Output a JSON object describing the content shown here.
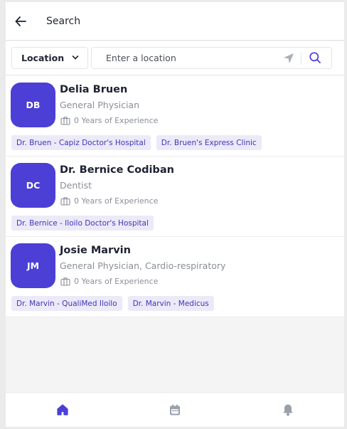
{
  "header": {
    "title": "Search",
    "back_icon": "arrow-left-icon"
  },
  "search": {
    "location_label": "Location",
    "placeholder": "Enter a location",
    "value": "",
    "icons": [
      "chevron-down-icon",
      "navigation-arrow-icon",
      "search-icon"
    ]
  },
  "doctors": [
    {
      "initials": "DB",
      "name": "Delia Bruen",
      "specialty": "General Physician",
      "experience": "0 Years of Experience",
      "clinics": [
        "Dr. Bruen - Capiz Doctor's Hospital",
        "Dr. Bruen's Express Clinic"
      ]
    },
    {
      "initials": "DC",
      "name": "Dr. Bernice Codiban",
      "specialty": "Dentist",
      "experience": "0 Years of Experience",
      "clinics": [
        "Dr. Bernice - Iloilo Doctor's Hospital"
      ]
    },
    {
      "initials": "JM",
      "name": "Josie Marvin",
      "specialty": "General Physician, Cardio-respiratory",
      "experience": "0 Years of Experience",
      "clinics": [
        "Dr. Marvin - QualiMed Iloilo",
        "Dr. Marvin - Medicus"
      ]
    }
  ],
  "bottom_nav": {
    "items": [
      {
        "icon": "home-icon",
        "active": true
      },
      {
        "icon": "calendar-icon",
        "active": false
      },
      {
        "icon": "bell-icon",
        "active": false
      }
    ]
  },
  "colors": {
    "accent": "#4b3fd6",
    "chip_bg": "#eceaf9",
    "chip_text": "#3d35b8",
    "muted_text": "#8a8e99",
    "inactive_icon": "#9aa0ab"
  }
}
